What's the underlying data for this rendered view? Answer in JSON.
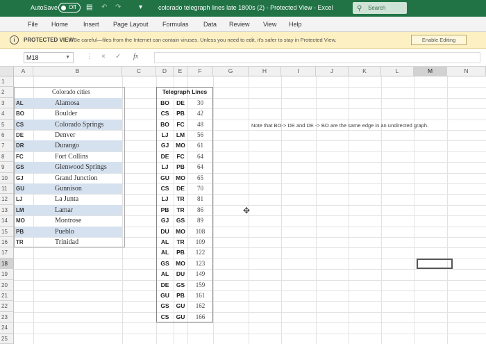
{
  "titlebar": {
    "autosave_label": "AutoSave",
    "autosave_state": "Off",
    "title": "colorado telegraph lines late 1800s (2)  -  Protected View  -  Excel",
    "search_placeholder": "Search"
  },
  "ribbon": {
    "tabs": [
      "File",
      "Home",
      "Insert",
      "Page Layout",
      "Formulas",
      "Data",
      "Review",
      "View",
      "Help"
    ]
  },
  "protected_view": {
    "label": "PROTECTED VIEW",
    "message": "Be careful—files from the Internet can contain viruses. Unless you need to edit, it's safer to stay in Protected View.",
    "button": "Enable Editing"
  },
  "formula_bar": {
    "name_box": "M18",
    "fx": "fx",
    "cancel": "×",
    "enter": "✓",
    "separator": "⋮",
    "value": ""
  },
  "columns": [
    "A",
    "B",
    "C",
    "D",
    "E",
    "F",
    "G",
    "H",
    "I",
    "J",
    "K",
    "L",
    "M",
    "N"
  ],
  "rows": [
    "1",
    "2",
    "3",
    "4",
    "5",
    "6",
    "7",
    "8",
    "9",
    "10",
    "11",
    "12",
    "13",
    "14",
    "15",
    "16",
    "17",
    "18",
    "19",
    "20",
    "21",
    "22",
    "23",
    "24",
    "25"
  ],
  "cities": {
    "header": "Colorado cities",
    "items": [
      {
        "code": "AL",
        "name": "Alamosa"
      },
      {
        "code": "BO",
        "name": "Boulder"
      },
      {
        "code": "CS",
        "name": "Colorado Springs"
      },
      {
        "code": "DE",
        "name": "Denver"
      },
      {
        "code": "DR",
        "name": "Durango"
      },
      {
        "code": "FC",
        "name": "Fort Collins"
      },
      {
        "code": "GS",
        "name": "Glenwood Springs"
      },
      {
        "code": "GJ",
        "name": "Grand Junction"
      },
      {
        "code": "GU",
        "name": "Gunnison"
      },
      {
        "code": "LJ",
        "name": "La Junta"
      },
      {
        "code": "LM",
        "name": "Lamar"
      },
      {
        "code": "MO",
        "name": "Montrose"
      },
      {
        "code": "PB",
        "name": "Pueblo"
      },
      {
        "code": "TR",
        "name": "Trinidad"
      }
    ]
  },
  "telegraph": {
    "header": "Telegraph Lines",
    "lines": [
      {
        "a": "BO",
        "b": "DE",
        "v": "30"
      },
      {
        "a": "CS",
        "b": "PB",
        "v": "42"
      },
      {
        "a": "BO",
        "b": "FC",
        "v": "48"
      },
      {
        "a": "LJ",
        "b": "LM",
        "v": "56"
      },
      {
        "a": "GJ",
        "b": "MO",
        "v": "61"
      },
      {
        "a": "DE",
        "b": "FC",
        "v": "64"
      },
      {
        "a": "LJ",
        "b": "PB",
        "v": "64"
      },
      {
        "a": "GU",
        "b": "MO",
        "v": "65"
      },
      {
        "a": "CS",
        "b": "DE",
        "v": "70"
      },
      {
        "a": "LJ",
        "b": "TR",
        "v": "81"
      },
      {
        "a": "PB",
        "b": "TR",
        "v": "86"
      },
      {
        "a": "GJ",
        "b": "GS",
        "v": "89"
      },
      {
        "a": "DU",
        "b": "MO",
        "v": "108"
      },
      {
        "a": "AL",
        "b": "TR",
        "v": "109"
      },
      {
        "a": "AL",
        "b": "PB",
        "v": "122"
      },
      {
        "a": "GS",
        "b": "MO",
        "v": "123"
      },
      {
        "a": "AL",
        "b": "DU",
        "v": "149"
      },
      {
        "a": "DE",
        "b": "GS",
        "v": "159"
      },
      {
        "a": "GU",
        "b": "PB",
        "v": "161"
      },
      {
        "a": "GS",
        "b": "GU",
        "v": "162"
      },
      {
        "a": "CS",
        "b": "GU",
        "v": "166"
      }
    ]
  },
  "note": "Note that BO-> DE  and DE -> BO are the same edge in an undirected graph.",
  "active_cell": "M18",
  "highlight_color": "#d5e1ef"
}
